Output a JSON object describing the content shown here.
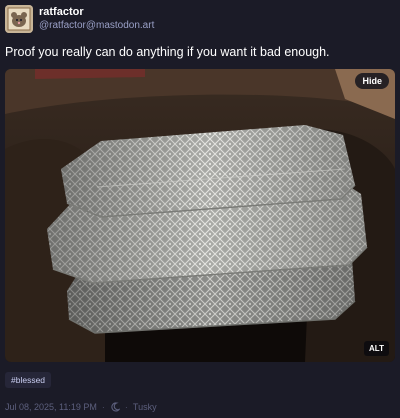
{
  "post": {
    "author_name": "ratfactor",
    "author_handle": "@ratfactor@mastodon.art",
    "text": "Proof you really can do anything if you want it bad enough.",
    "media": {
      "hide_label": "Hide",
      "alt_label": "ALT"
    },
    "hashtag": "#blessed",
    "timestamp": "Jul 08, 2025, 11:19 PM",
    "separator": "·",
    "visibility_icon": "moon-icon",
    "client": "Tusky"
  },
  "colors": {
    "background": "#1b1b27",
    "handle": "#9aa0c7",
    "hashtag_bg": "#262638",
    "meta": "#5c5f7d"
  }
}
